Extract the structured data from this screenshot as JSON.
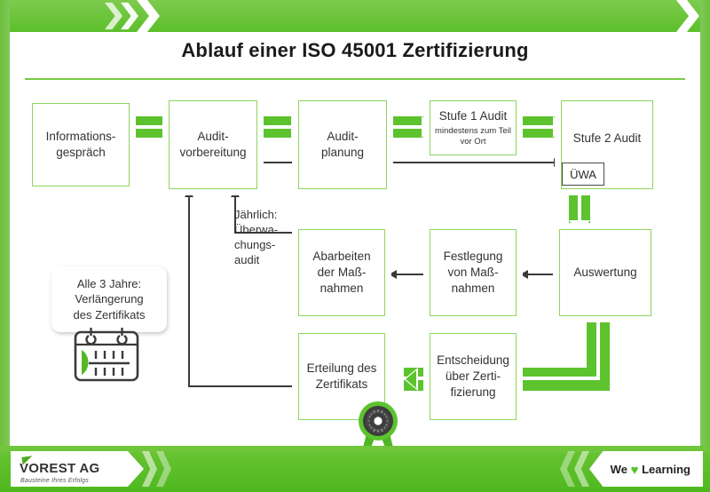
{
  "header": {
    "title": "Ablauf einer ISO 45001 Zertifizierung"
  },
  "footer": {
    "logo_name": "VOREST AG",
    "logo_tagline": "Bausteine Ihres Erfolgs",
    "slogan_pre": "We",
    "slogan_heart": "♥",
    "slogan_post": "Learning"
  },
  "chart_data": {
    "type": "diagram",
    "title": "Ablauf einer ISO 45001 Zertifizierung",
    "nodes": [
      {
        "id": "n1",
        "label": "Informations-\ngespräch"
      },
      {
        "id": "n2",
        "label": "Audit-\nvorbereitung"
      },
      {
        "id": "n3",
        "label": "Audit-\nplanung"
      },
      {
        "id": "n4",
        "label": "Stufe 1 Audit",
        "sublabel": "mindestens zum Teil vor Ort"
      },
      {
        "id": "n5",
        "label": "Stufe 2 Audit",
        "badge": "ÜWA"
      },
      {
        "id": "n6",
        "label": "Auswertung"
      },
      {
        "id": "n7",
        "label": "Festlegung\nvon Maß-\nnahmen"
      },
      {
        "id": "n8",
        "label": "Abarbeiten\nder Maß-\nnahmen"
      },
      {
        "id": "n9",
        "label": "Entscheidung\nüber Zerti-\nfizierung"
      },
      {
        "id": "n10",
        "label": "Erteilung des\nZertifikats"
      }
    ],
    "annotations": [
      {
        "id": "a1",
        "label": "Jährlich:\nÜberwa-\nchungs-\naudit"
      },
      {
        "id": "a2",
        "label": "Alle 3 Jahre:\nVerlängerung\ndes Zertifikats"
      }
    ],
    "edges": [
      {
        "from": "n1",
        "to": "n2",
        "style": "thick-green"
      },
      {
        "from": "n2",
        "to": "n3",
        "style": "thick-green"
      },
      {
        "from": "n3",
        "to": "n4",
        "style": "thick-green"
      },
      {
        "from": "n4",
        "to": "n5",
        "style": "thick-green"
      },
      {
        "from": "n2",
        "to": "n3",
        "style": "thin-black"
      },
      {
        "from": "n3",
        "to": "n5",
        "style": "thin-black"
      },
      {
        "from": "n5",
        "to": "n6",
        "style": "thick-green"
      },
      {
        "from": "n6",
        "to": "n7",
        "style": "thin-black"
      },
      {
        "from": "n7",
        "to": "n8",
        "style": "thin-black"
      },
      {
        "from": "n8",
        "to": "n2",
        "style": "thin-black",
        "label": "a1"
      },
      {
        "from": "n6",
        "to": "n9",
        "style": "thick-green"
      },
      {
        "from": "n9",
        "to": "n10",
        "style": "thick-green"
      },
      {
        "from": "n10",
        "to": "n2",
        "style": "thin-black"
      }
    ]
  },
  "nodes": {
    "informationsgespraech": {
      "line1": "Informations-",
      "line2": "gespräch"
    },
    "auditvorbereitung": {
      "line1": "Audit-",
      "line2": "vorbereitung"
    },
    "auditplanung": {
      "line1": "Audit-",
      "line2": "planung"
    },
    "stufe1": {
      "title": "Stufe 1 Audit",
      "sub1": "mindestens zum Teil",
      "sub2": "vor Ort"
    },
    "stufe2": {
      "title": "Stufe 2 Audit",
      "badge": "ÜWA"
    },
    "auswertung": {
      "title": "Auswertung"
    },
    "festlegung": {
      "line1": "Festlegung",
      "line2": "von Maß-",
      "line3": "nahmen"
    },
    "abarbeiten": {
      "line1": "Abarbeiten",
      "line2": "der Maß-",
      "line3": "nahmen"
    },
    "entscheidung": {
      "line1": "Entscheidung",
      "line2": "über Zerti-",
      "line3": "fizierung"
    },
    "erteilung": {
      "line1": "Erteilung des",
      "line2": "Zertifikats"
    }
  },
  "annotations": {
    "jaehrlich": {
      "l1": "Jährlich:",
      "l2": "Überwa-",
      "l3": "chungs-",
      "l4": "audit"
    },
    "alle3jahre": {
      "l1": "Alle 3 Jahre:",
      "l2": "Verlängerung",
      "l3": "des Zertifikats"
    }
  },
  "colors": {
    "green": "#5cc32e",
    "green_band": "#67c232",
    "green_border": "#8ed45f",
    "text": "#333333",
    "rule": "#7ac943"
  }
}
